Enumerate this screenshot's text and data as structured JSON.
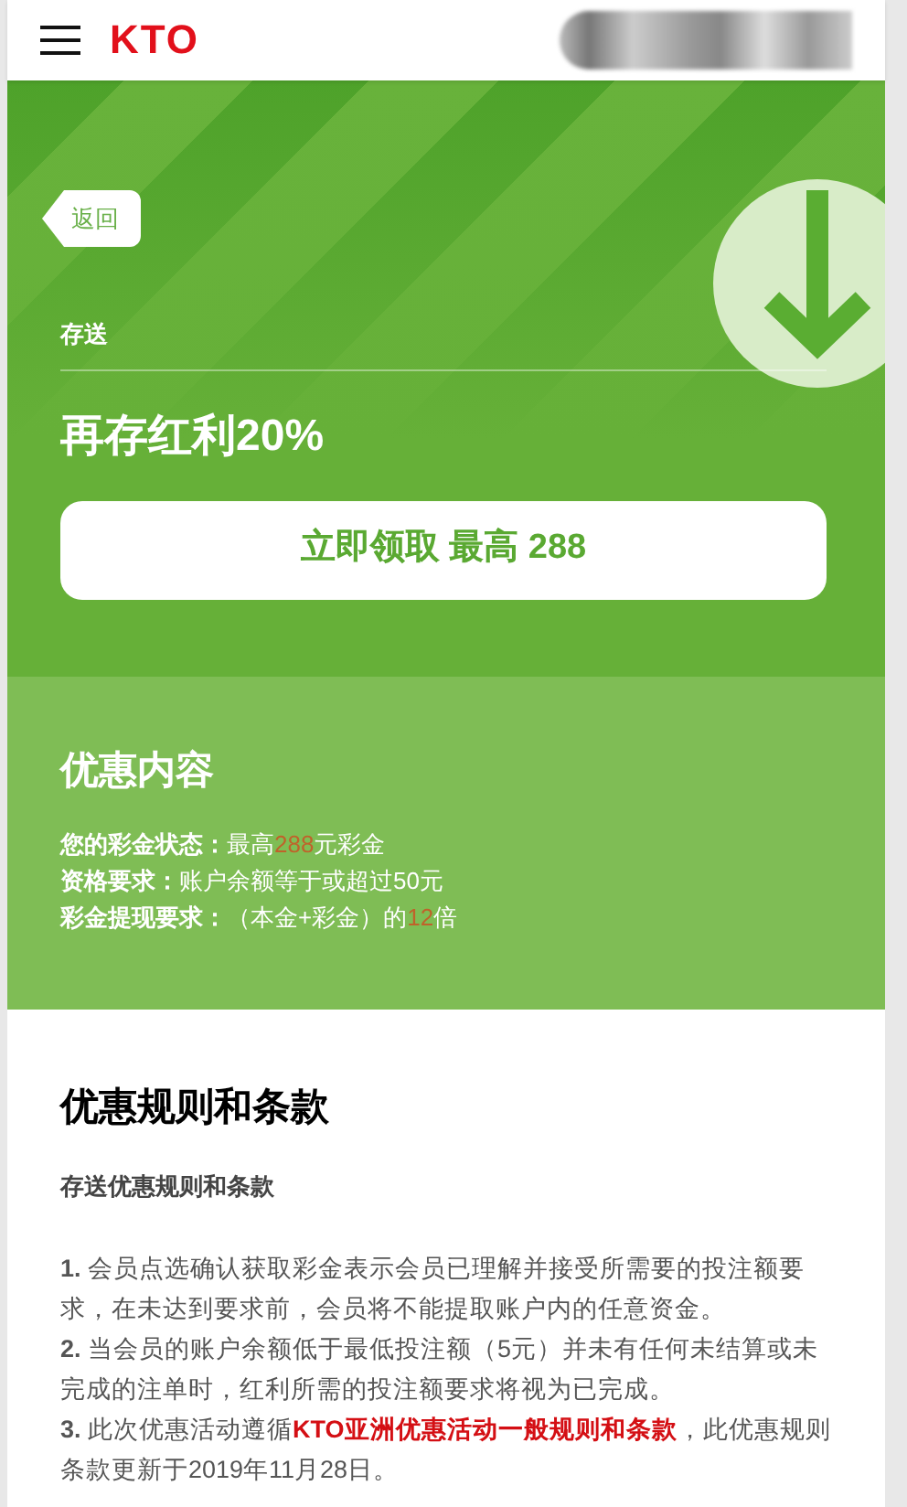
{
  "header": {
    "logo": "KTO"
  },
  "hero": {
    "back": "返回",
    "category": "存送",
    "title": "再存红利20%",
    "claim_button": "立即领取 最高 288"
  },
  "offer": {
    "title": "优惠内容",
    "lines": [
      {
        "label": "您的彩金状态：",
        "before": "最高",
        "highlight": "288",
        "after": "元彩金"
      },
      {
        "label": "资格要求：",
        "before": "账户余额等于或超过50元"
      },
      {
        "label": "彩金提现要求：",
        "before": "（本金+彩金）的",
        "highlight": "12",
        "after": "倍"
      }
    ]
  },
  "terms": {
    "title": "优惠规则和条款",
    "subtitle": "存送优惠规则和条款",
    "rules": [
      {
        "number": "1.",
        "text": "会员点选确认获取彩金表示会员已理解并接受所需要的投注额要求，在未达到要求前，会员将不能提取账户内的任意资金。"
      },
      {
        "number": "2.",
        "text": "当会员的账户余额低于最低投注额（5元）并未有任何未结算或未完成的注单时，红利所需的投注额要求将视为已完成。"
      },
      {
        "number": "3.",
        "text": "此次优惠活动遵循",
        "link": "KTO亚洲优惠活动一般规则和条款",
        "after": "，此优惠规则条款更新于2019年11月28日。"
      }
    ]
  }
}
